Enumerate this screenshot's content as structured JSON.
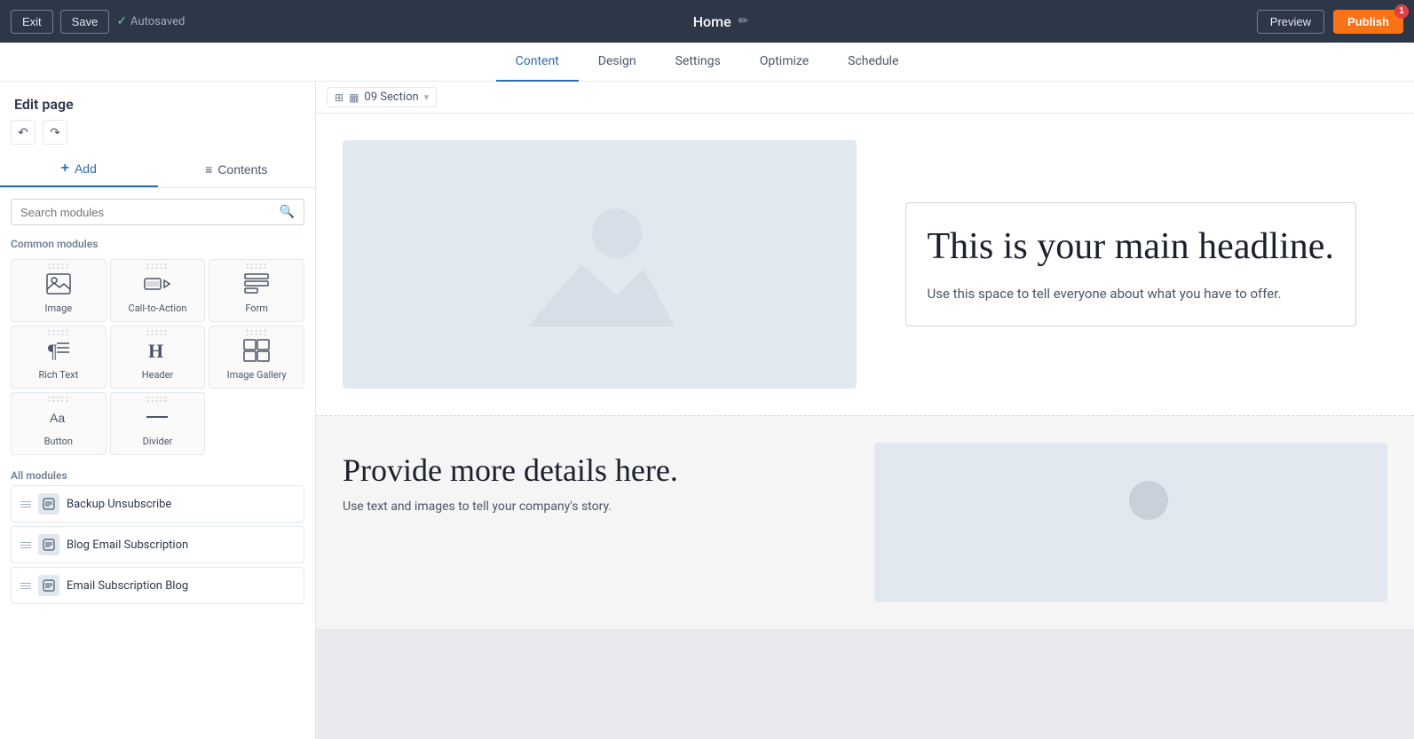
{
  "topbar": {
    "exit_label": "Exit",
    "save_label": "Save",
    "autosaved_label": "Autosaved",
    "page_title": "Home",
    "preview_label": "Preview",
    "publish_label": "Publish",
    "publish_badge": "1"
  },
  "tabs": [
    {
      "id": "content",
      "label": "Content",
      "active": true
    },
    {
      "id": "design",
      "label": "Design",
      "active": false
    },
    {
      "id": "settings",
      "label": "Settings",
      "active": false
    },
    {
      "id": "optimize",
      "label": "Optimize",
      "active": false
    },
    {
      "id": "schedule",
      "label": "Schedule",
      "active": false
    }
  ],
  "sidebar": {
    "title": "Edit page",
    "add_label": "+ Add",
    "contents_label": "Contents",
    "search_placeholder": "Search modules",
    "common_modules_label": "Common modules",
    "all_modules_label": "All modules",
    "modules": [
      {
        "id": "image",
        "label": "Image",
        "icon": "🖼"
      },
      {
        "id": "cta",
        "label": "Call-to-Action",
        "icon": "🖱"
      },
      {
        "id": "form",
        "label": "Form",
        "icon": "📋"
      },
      {
        "id": "rich-text",
        "label": "Rich Text",
        "icon": "¶"
      },
      {
        "id": "header",
        "label": "Header",
        "icon": "H"
      },
      {
        "id": "image-gallery",
        "label": "Image Gallery",
        "icon": "⊞"
      },
      {
        "id": "button",
        "label": "Button",
        "icon": "Aa"
      },
      {
        "id": "divider",
        "label": "Divider",
        "icon": "—"
      }
    ],
    "all_modules_list": [
      {
        "id": "backup-unsubscribe",
        "label": "Backup Unsubscribe"
      },
      {
        "id": "blog-email-subscription",
        "label": "Blog Email Subscription"
      },
      {
        "id": "email-subscription-blog",
        "label": "Email Subscription Blog"
      }
    ]
  },
  "section_toolbar": {
    "label": "09 Section"
  },
  "canvas": {
    "main_headline": "This is your main headline.",
    "main_subtext": "Use this space to tell everyone about what you have to offer.",
    "second_headline": "Provide more details here.",
    "second_subtext": "Use text and images to tell your company's story."
  }
}
